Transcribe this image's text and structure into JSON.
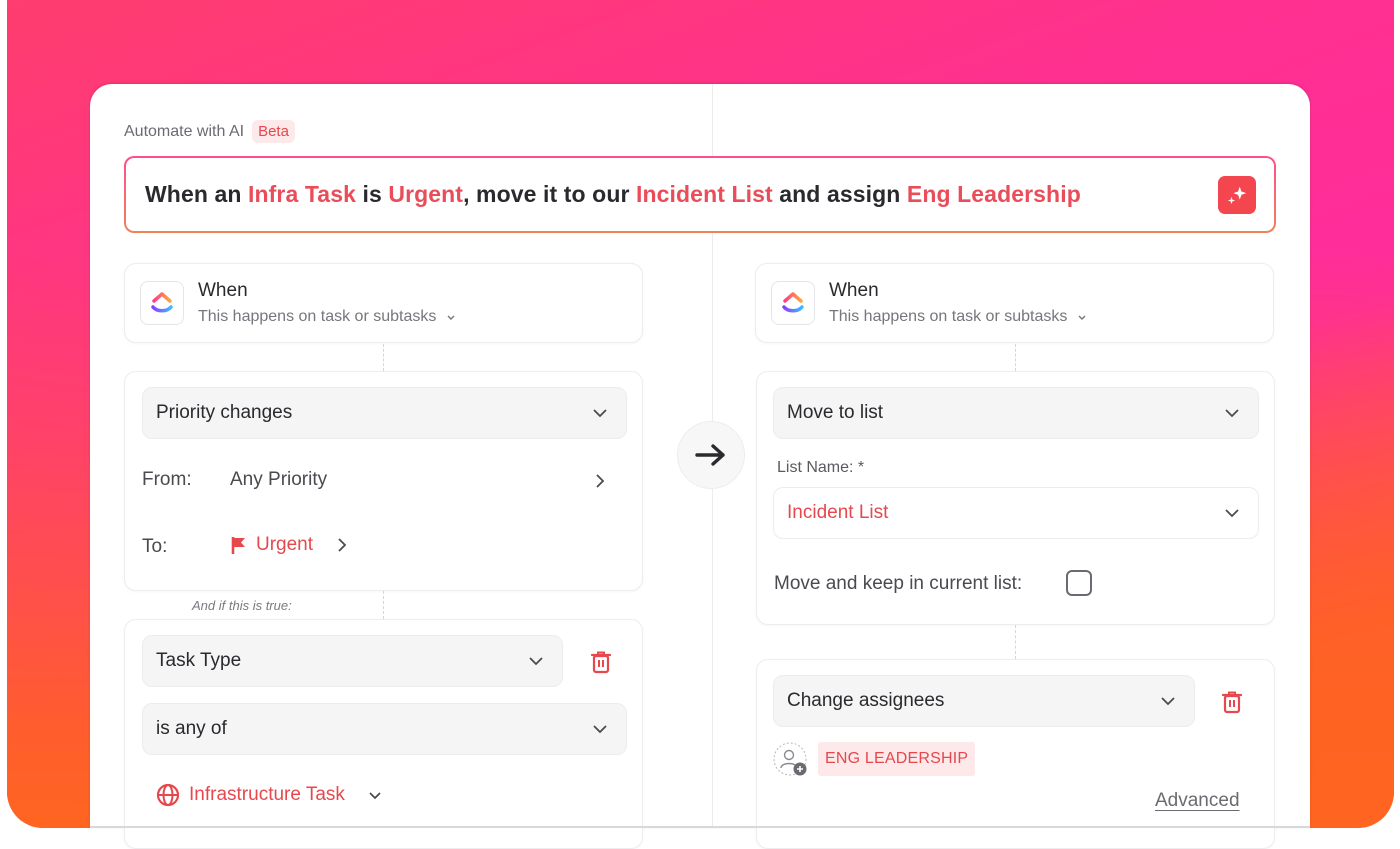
{
  "header": {
    "title": "Automate with AI",
    "badge": "Beta"
  },
  "prompt": {
    "segments": [
      {
        "text": "When an ",
        "highlight": false
      },
      {
        "text": "Infra Task",
        "highlight": true
      },
      {
        "text": " is ",
        "highlight": false
      },
      {
        "text": "Urgent",
        "highlight": true
      },
      {
        "text": ", move it to our ",
        "highlight": false
      },
      {
        "text": "Incident List",
        "highlight": true
      },
      {
        "text": " and assign ",
        "highlight": false
      },
      {
        "text": "Eng Leadership",
        "highlight": true
      }
    ],
    "generate_icon": "sparkles-icon"
  },
  "left": {
    "trigger": {
      "title": "When",
      "subtitle": "This happens on task or subtasks"
    },
    "event": {
      "select": "Priority changes",
      "from_label": "From:",
      "from_value": "Any Priority",
      "to_label": "To:",
      "to_value": "Urgent"
    },
    "condition_note": "And if this is true:",
    "condition": {
      "field": "Task Type",
      "operator": "is any of",
      "value": "Infrastructure Task"
    }
  },
  "right": {
    "trigger": {
      "title": "When",
      "subtitle": "This happens on task or subtasks"
    },
    "action1": {
      "select": "Move to list",
      "list_name_label": "List Name: *",
      "list_name_value": "Incident List",
      "keep_label": "Move and keep in current list:",
      "keep_checked": false
    },
    "action2": {
      "select": "Change assignees",
      "assignee_tag": "ENG LEADERSHIP",
      "advanced_link": "Advanced"
    }
  },
  "colors": {
    "accent": "#E5484D",
    "gradient_top": "#FF2E8A",
    "gradient_bottom": "#FF6520"
  }
}
